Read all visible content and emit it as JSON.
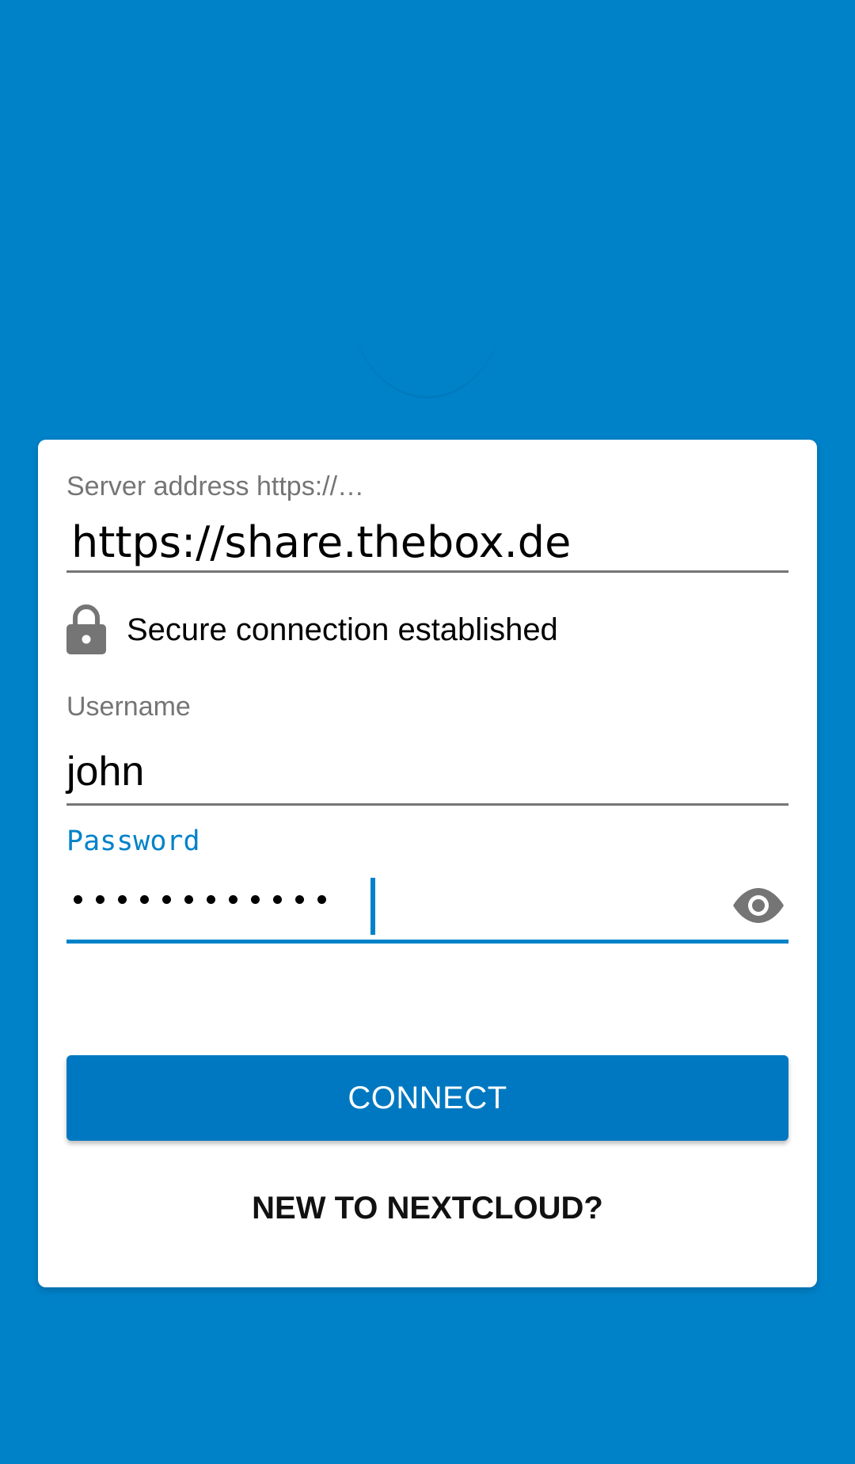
{
  "login": {
    "server_label": "Server address https://…",
    "server_value": "https://share.thebox.de",
    "secure_status": "Secure connection established",
    "username_label": "Username",
    "username_value": "john",
    "password_label": "Password",
    "password_length": 12,
    "connect_label": "CONNECT",
    "new_link_label": "NEW TO NEXTCLOUD?"
  },
  "icons": {
    "lock": "lock-icon",
    "eye": "eye-icon"
  },
  "colors": {
    "background": "#0082c9",
    "accent": "#0082c9",
    "button": "#0078c1"
  }
}
